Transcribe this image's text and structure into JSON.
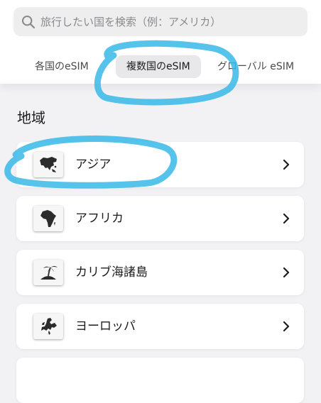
{
  "search": {
    "placeholder": "旅行したい国を検索（例：アメリカ）"
  },
  "tabs": [
    {
      "label": "各国のeSIM",
      "active": false
    },
    {
      "label": "複数国のeSIM",
      "active": true
    },
    {
      "label": "グローバル eSIM",
      "active": false
    }
  ],
  "section": {
    "title": "地域"
  },
  "regions": [
    {
      "label": "アジア",
      "icon": "asia-map-icon"
    },
    {
      "label": "アフリカ",
      "icon": "africa-map-icon"
    },
    {
      "label": "カリブ海諸島",
      "icon": "palm-island-icon"
    },
    {
      "label": "ヨーロッパ",
      "icon": "europe-map-icon"
    }
  ],
  "colors": {
    "annotation": "#38b8e8",
    "background": "#f2f2f4",
    "active_tab": "#e8e8ea"
  }
}
